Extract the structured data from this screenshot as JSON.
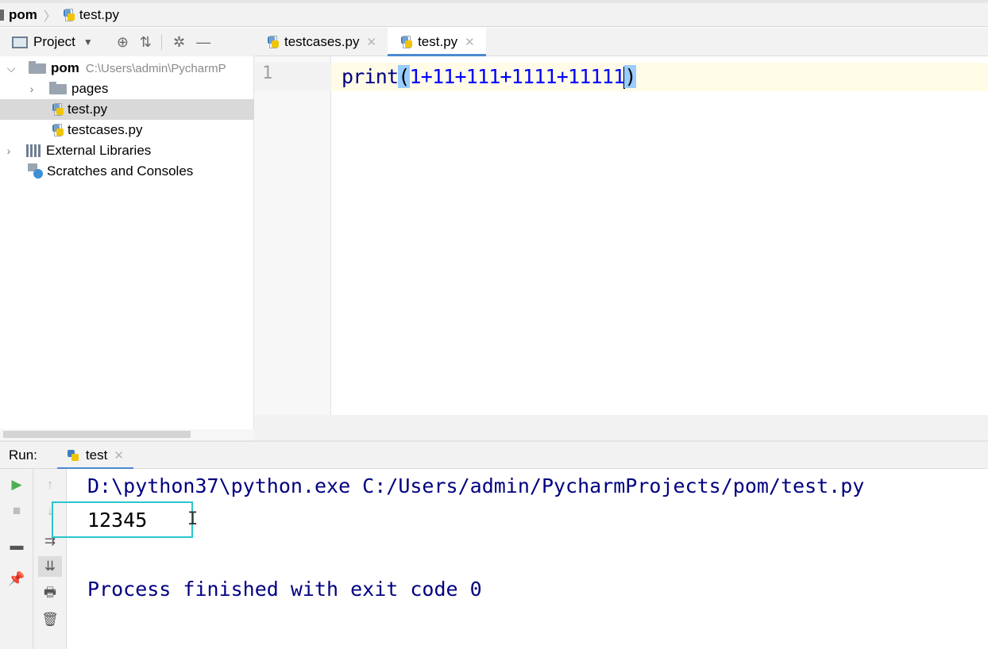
{
  "breadcrumb": {
    "root": "pom",
    "file": "test.py"
  },
  "project_panel": {
    "title": "Project",
    "tree": [
      {
        "label": "pom",
        "path": "C:\\Users\\admin\\PycharmP"
      },
      {
        "label": "pages"
      },
      {
        "label": "test.py"
      },
      {
        "label": "testcases.py"
      },
      {
        "label": "External Libraries"
      },
      {
        "label": "Scratches and Consoles"
      }
    ]
  },
  "editor": {
    "tabs": [
      {
        "label": "testcases.py"
      },
      {
        "label": "test.py"
      }
    ],
    "line_number": "1",
    "code": {
      "fn": "print",
      "open": "(",
      "expr": "1+11+111+1111+11111",
      "close": ")"
    }
  },
  "run_panel": {
    "label": "Run:",
    "tab": "test",
    "command": "D:\\python37\\python.exe C:/Users/admin/PycharmProjects/pom/test.py",
    "output": "12345",
    "exit": "Process finished with exit code 0"
  },
  "colors": {
    "highlight_box": "#28c6cc",
    "active_tab_underline": "#4b8ad1",
    "console_blue": "#000080"
  }
}
